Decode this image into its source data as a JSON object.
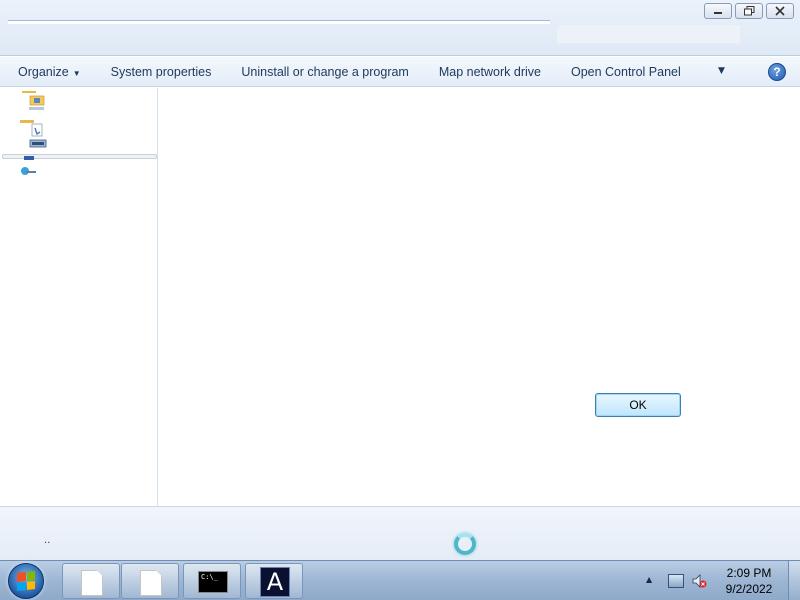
{
  "window": {
    "controls": {
      "minimize_icon": "minimize-icon",
      "restore_icon": "restore-icon",
      "close_icon": "close-icon"
    }
  },
  "command_bar": {
    "organize": "Organize",
    "system_properties": "System properties",
    "uninstall": "Uninstall or change a program",
    "map_drive": "Map network drive",
    "control_panel": "Open Control Panel",
    "help_glyph": "?"
  },
  "dialog": {
    "ok_label": "OK"
  },
  "details_pane": {
    "text": ".."
  },
  "taskbar": {
    "cmd_prompt_text": "C:\\_",
    "app_letter": "A",
    "time": "2:09 PM",
    "date": "9/2/2022"
  },
  "colors": {
    "accent": "#3c7fb1",
    "taskbar": "#9db6d3",
    "chrome": "#dfe9f5"
  }
}
